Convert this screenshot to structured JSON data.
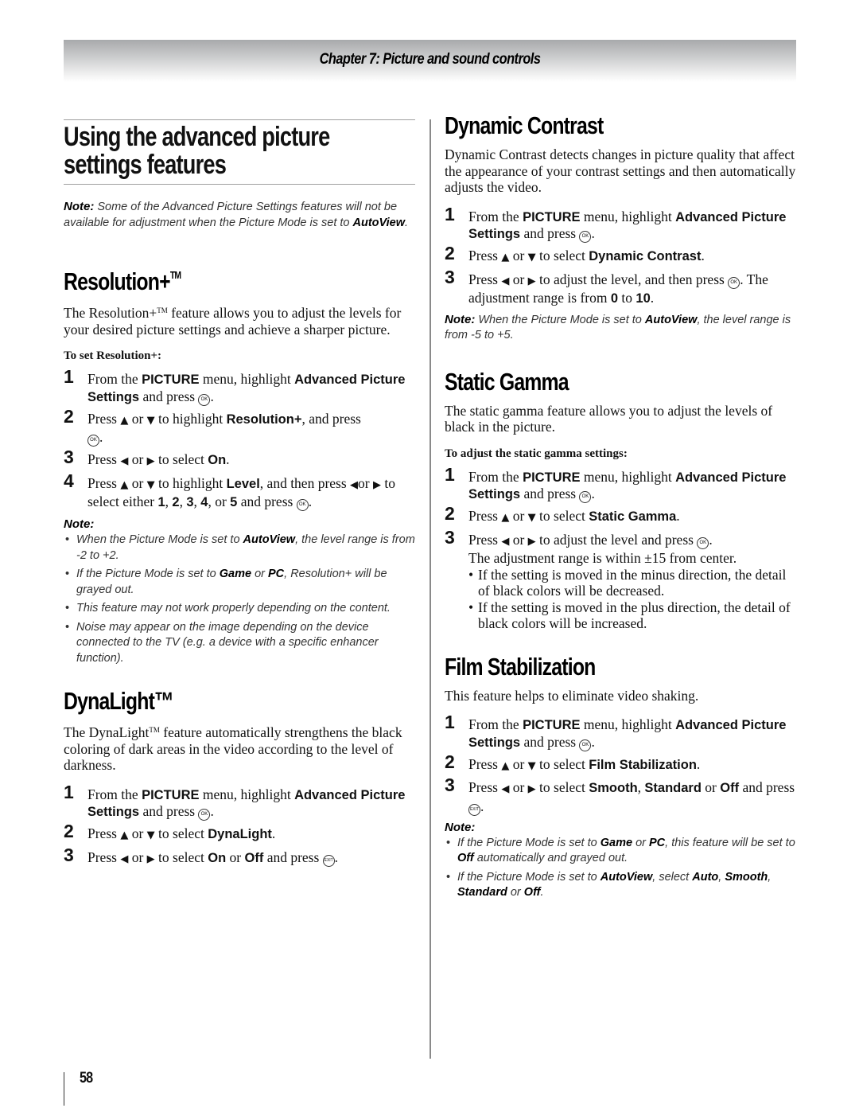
{
  "header": {
    "chapter_title": "Chapter 7: Picture and sound controls"
  },
  "left": {
    "page_title_line1": "Using the advanced picture",
    "page_title_line2": "settings features",
    "intro_note": {
      "label": "Note:",
      "text_before": " Some of the Advanced Picture Settings features will not be available for adjustment when the Picture Mode is set to ",
      "bold": "AutoView",
      "text_after": "."
    },
    "resolution": {
      "heading": "Resolution+",
      "tm": "TM",
      "body_before": "The Resolution+",
      "body_after": " feature allows you to adjust the levels for your desired picture settings and achieve a sharper picture.",
      "subheading": "To set Resolution+:",
      "steps": [
        {
          "num": "1",
          "t1": "From the ",
          "b1": "PICTURE",
          "t2": " menu, highlight ",
          "b2": "Advanced Picture Settings",
          "t3": " and press ",
          "icon": "OK",
          "t4": "."
        },
        {
          "num": "2",
          "t1": "Press ",
          "up": "▲",
          "t2": " or ",
          "down": "▼",
          "t3": " to highlight ",
          "b1": "Resolution+",
          "t4": ", and press ",
          "icon": "OK",
          "t5": "."
        },
        {
          "num": "3",
          "t1": "Press ",
          "left": "◀",
          "t2": " or ",
          "right": "▶",
          "t3": " to select ",
          "b1": "On",
          "t4": "."
        },
        {
          "num": "4",
          "t1": "Press ",
          "up": "▲",
          "t2": " or ",
          "down": "▼",
          "t3": " to highlight ",
          "b1": "Level",
          "t4": ", and then press ",
          "left": "◀",
          "t5": "or ",
          "right": "▶",
          "t6": " to select either ",
          "n1": "1",
          "n2": "2",
          "n3": "3",
          "n4": "4",
          "n5": "5",
          "t7": " and press ",
          "icon": "OK",
          "t8": "."
        }
      ],
      "note_label": "Note:",
      "notes": [
        {
          "t1": "When the Picture Mode is set to ",
          "b1": "AutoView",
          "t2": ", the level range is from -2 to +2."
        },
        {
          "t1": "If the Picture Mode is set to ",
          "b1": "Game",
          "t2": " or  ",
          "b2": "PC",
          "t3": ", Resolution+ will be grayed out."
        },
        {
          "t1": "This feature may not work properly depending on the content."
        },
        {
          "t1": "Noise may appear on the image depending on the device connected to the TV (e.g. a device with a specific enhancer function)."
        }
      ]
    },
    "dynalight": {
      "heading": "DynaLight",
      "tm": "™",
      "body_before": "The DynaLight",
      "body_after": " feature automatically strengthens the black coloring of dark areas in the video according to the level of darkness.",
      "steps": [
        {
          "num": "1",
          "t1": "From the ",
          "b1": "PICTURE",
          "t2": " menu, highlight ",
          "b2": "Advanced Picture Settings",
          "t3": " and press ",
          "icon": "OK",
          "t4": "."
        },
        {
          "num": "2",
          "t1": "Press ",
          "up": "▲",
          "t2": " or ",
          "down": "▼",
          "t3": " to select ",
          "b1": "DynaLight",
          "t4": "."
        },
        {
          "num": "3",
          "t1": "Press ",
          "left": "◀",
          "t2": " or ",
          "right": "▶",
          "t3": " to select ",
          "b1": "On",
          "t4": " or ",
          "b2": "Off",
          "t5": " and press ",
          "icon": "EXIT",
          "t6": "."
        }
      ]
    }
  },
  "right": {
    "dynamic_contrast": {
      "heading": "Dynamic Contrast",
      "body": "Dynamic Contrast detects changes in picture quality that affect the appearance of your contrast settings and then automatically adjusts the video.",
      "steps": [
        {
          "num": "1",
          "t1": "From the ",
          "b1": "PICTURE",
          "t2": " menu, highlight ",
          "b2": "Advanced Picture Settings",
          "t3": " and press ",
          "icon": "OK",
          "t4": "."
        },
        {
          "num": "2",
          "t1": "Press ",
          "up": "▲",
          "t2": " or ",
          "down": "▼",
          "t3": " to select ",
          "b1": "Dynamic Contrast",
          "t4": "."
        },
        {
          "num": "3",
          "t1": "Press ",
          "left": "◀",
          "t2": " or ",
          "right": "▶",
          "t3": " to adjust the level, and then press ",
          "icon": "OK",
          "t4": ". The adjustment range is from ",
          "b1": "0",
          "t5": " to ",
          "b2": "10",
          "t6": "."
        }
      ],
      "note": {
        "label": "Note:",
        "t1": " When the Picture Mode is set to ",
        "b1": "AutoView",
        "t2": ", the level range is from -5 to +5."
      }
    },
    "static_gamma": {
      "heading": "Static Gamma",
      "body": "The static gamma feature allows you to adjust the levels of black in the picture.",
      "subheading": "To adjust the static gamma settings:",
      "steps": [
        {
          "num": "1",
          "t1": "From the ",
          "b1": "PICTURE",
          "t2": " menu, highlight ",
          "b2": "Advanced Picture Settings",
          "t3": " and press ",
          "icon": "OK",
          "t4": "."
        },
        {
          "num": "2",
          "t1": "Press ",
          "up": "▲",
          "t2": " or ",
          "down": "▼",
          "t3": " to select  ",
          "b1": "Static Gamma",
          "t4": "."
        },
        {
          "num": "3",
          "t1": "Press ",
          "left": "◀",
          "t2": " or ",
          "right": "▶",
          "t3": " to adjust the level and press ",
          "icon": "OK",
          "t4": ".",
          "t5": "The adjustment range is within ±15 from center."
        }
      ],
      "bullets": [
        "If the setting is moved in the minus direction, the detail of black colors will be decreased.",
        "If the setting is moved in the plus direction, the detail of black colors will be increased."
      ]
    },
    "film_stabilization": {
      "heading": "Film Stabilization",
      "body": "This feature helps to eliminate video shaking.",
      "steps": [
        {
          "num": "1",
          "t1": "From the ",
          "b1": "PICTURE",
          "t2": " menu, highlight ",
          "b2": "Advanced Picture Settings",
          "t3": " and press ",
          "icon": "OK",
          "t4": "."
        },
        {
          "num": "2",
          "t1": "Press ",
          "up": "▲",
          "t2": " or ",
          "down": "▼",
          "t3": " to select ",
          "b1": "Film Stabilization",
          "t4": "."
        },
        {
          "num": "3",
          "t1": "Press ",
          "left": "◀",
          "t2": " or ",
          "right": "▶",
          "t3": " to select ",
          "b1": "Smooth",
          "t4": ", ",
          "b2": "Standard",
          "t5": " or ",
          "b3": "Off",
          "t6": " and press ",
          "icon": "EXIT",
          "t7": "."
        }
      ],
      "note_label": "Note:",
      "notes": [
        {
          "t1": "If the Picture Mode is set to ",
          "b1": "Game",
          "t2": " or ",
          "b2": "PC",
          "t3": ", this feature will be set to ",
          "b3": "Off",
          "t4": " automatically and grayed out."
        },
        {
          "t1": "If the Picture Mode is set to ",
          "b1": "AutoView",
          "t2": ", select ",
          "b2": "Auto",
          "t3": ", ",
          "b4": "Smooth",
          "t4": ", ",
          "b5": "Standard",
          "t5": " or ",
          "b6": "Off",
          "t6": "."
        }
      ]
    }
  },
  "footer": {
    "page_number": "58"
  }
}
